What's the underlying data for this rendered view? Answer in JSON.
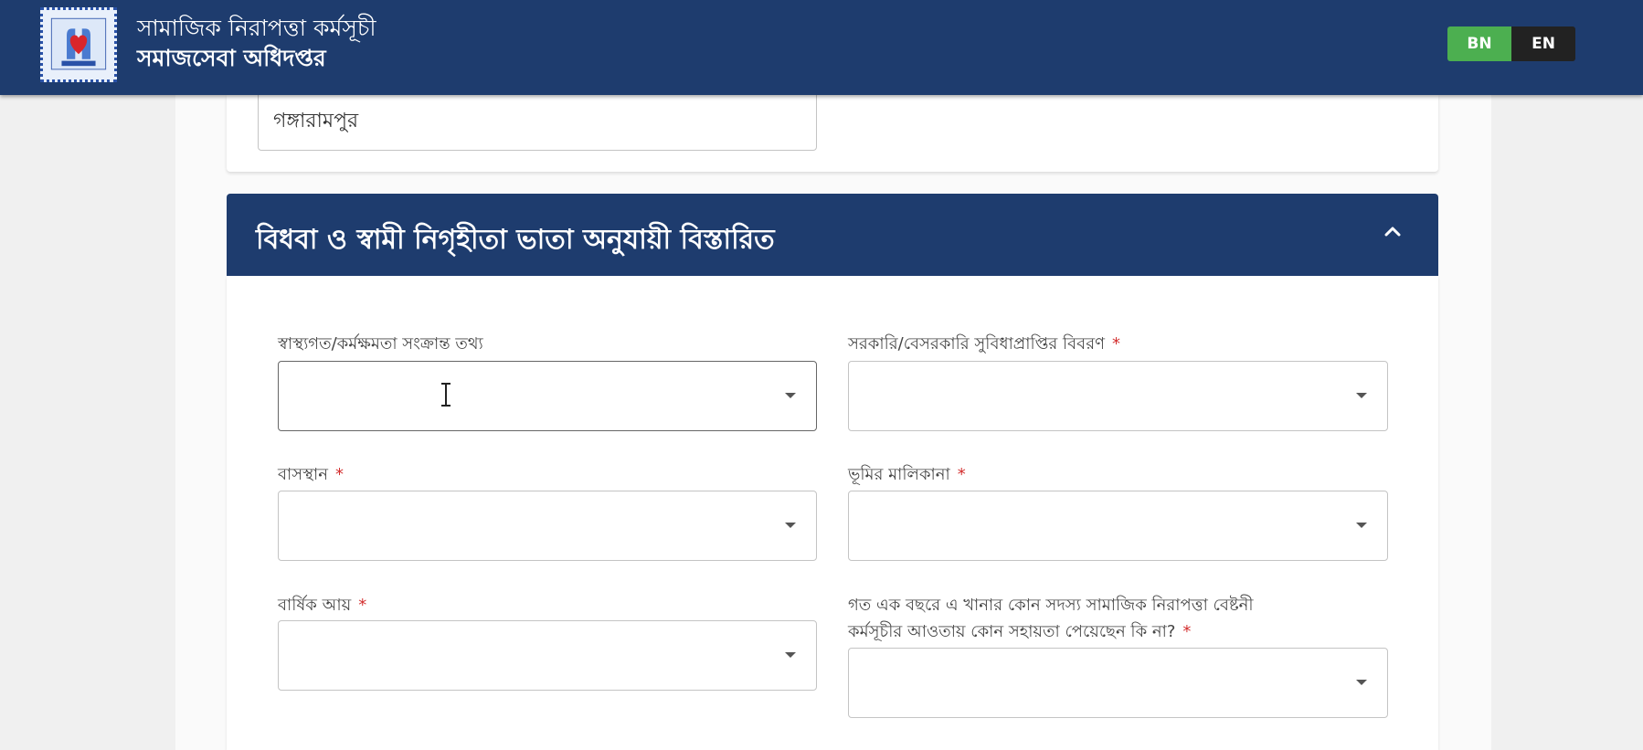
{
  "header": {
    "title_line1": "সামাজিক নিরাপত্তা কর্মসূচী",
    "title_line2": "সমাজসেবা অধিদপ্তর",
    "logo_icon": "department-of-social-services-logo",
    "lang_bn": "BN",
    "lang_en": "EN",
    "active_lang": "BN",
    "colors": {
      "header_bg": "#1e3c6e",
      "bn_active": "#4caf50",
      "en_bg": "#222222"
    }
  },
  "address": {
    "upazila_value": "গঙ্গারামপুর"
  },
  "section": {
    "title": "বিধবা ও স্বামী নিগৃহীতা ভাতা অনুযায়ী বিস্তারিত",
    "chevron_icon": "chevron-up-icon",
    "fields": [
      {
        "label": "স্বাস্থ্যগত/কর্মক্ষমতা সংক্রান্ত তথ্য",
        "required": false,
        "value": ""
      },
      {
        "label": "সরকারি/বেসরকারি সুবিধাপ্রাপ্তির বিবরণ",
        "required": true,
        "value": ""
      },
      {
        "label": "বাসস্থান",
        "required": true,
        "value": ""
      },
      {
        "label": "ভূমির মালিকানা",
        "required": true,
        "value": ""
      },
      {
        "label": "বার্ষিক আয়",
        "required": true,
        "value": ""
      },
      {
        "label": "গত এক বছরে এ খানার কোন সদস্য সামাজিক নিরাপত্তা বেষ্টনী",
        "label_line2": "কর্মসূচীর আওতায় কোন সহায়তা পেয়েছেন কি না?",
        "required": true,
        "value": ""
      }
    ],
    "required_mark": "*"
  }
}
